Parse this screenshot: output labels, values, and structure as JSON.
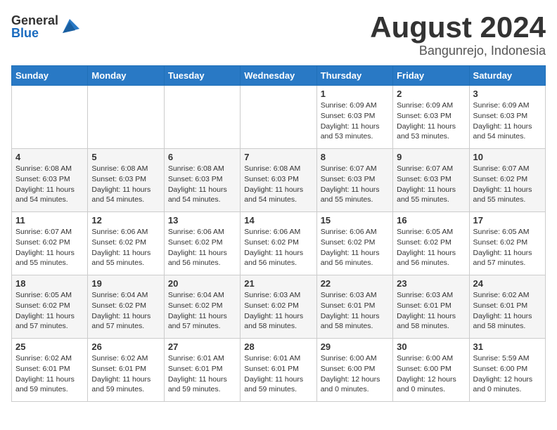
{
  "logo": {
    "general": "General",
    "blue": "Blue"
  },
  "title": {
    "month_year": "August 2024",
    "location": "Bangunrejo, Indonesia"
  },
  "weekdays": [
    "Sunday",
    "Monday",
    "Tuesday",
    "Wednesday",
    "Thursday",
    "Friday",
    "Saturday"
  ],
  "weeks": [
    [
      {
        "day": "",
        "info": ""
      },
      {
        "day": "",
        "info": ""
      },
      {
        "day": "",
        "info": ""
      },
      {
        "day": "",
        "info": ""
      },
      {
        "day": "1",
        "info": "Sunrise: 6:09 AM\nSunset: 6:03 PM\nDaylight: 11 hours\nand 53 minutes."
      },
      {
        "day": "2",
        "info": "Sunrise: 6:09 AM\nSunset: 6:03 PM\nDaylight: 11 hours\nand 53 minutes."
      },
      {
        "day": "3",
        "info": "Sunrise: 6:09 AM\nSunset: 6:03 PM\nDaylight: 11 hours\nand 54 minutes."
      }
    ],
    [
      {
        "day": "4",
        "info": "Sunrise: 6:08 AM\nSunset: 6:03 PM\nDaylight: 11 hours\nand 54 minutes."
      },
      {
        "day": "5",
        "info": "Sunrise: 6:08 AM\nSunset: 6:03 PM\nDaylight: 11 hours\nand 54 minutes."
      },
      {
        "day": "6",
        "info": "Sunrise: 6:08 AM\nSunset: 6:03 PM\nDaylight: 11 hours\nand 54 minutes."
      },
      {
        "day": "7",
        "info": "Sunrise: 6:08 AM\nSunset: 6:03 PM\nDaylight: 11 hours\nand 54 minutes."
      },
      {
        "day": "8",
        "info": "Sunrise: 6:07 AM\nSunset: 6:03 PM\nDaylight: 11 hours\nand 55 minutes."
      },
      {
        "day": "9",
        "info": "Sunrise: 6:07 AM\nSunset: 6:03 PM\nDaylight: 11 hours\nand 55 minutes."
      },
      {
        "day": "10",
        "info": "Sunrise: 6:07 AM\nSunset: 6:02 PM\nDaylight: 11 hours\nand 55 minutes."
      }
    ],
    [
      {
        "day": "11",
        "info": "Sunrise: 6:07 AM\nSunset: 6:02 PM\nDaylight: 11 hours\nand 55 minutes."
      },
      {
        "day": "12",
        "info": "Sunrise: 6:06 AM\nSunset: 6:02 PM\nDaylight: 11 hours\nand 55 minutes."
      },
      {
        "day": "13",
        "info": "Sunrise: 6:06 AM\nSunset: 6:02 PM\nDaylight: 11 hours\nand 56 minutes."
      },
      {
        "day": "14",
        "info": "Sunrise: 6:06 AM\nSunset: 6:02 PM\nDaylight: 11 hours\nand 56 minutes."
      },
      {
        "day": "15",
        "info": "Sunrise: 6:06 AM\nSunset: 6:02 PM\nDaylight: 11 hours\nand 56 minutes."
      },
      {
        "day": "16",
        "info": "Sunrise: 6:05 AM\nSunset: 6:02 PM\nDaylight: 11 hours\nand 56 minutes."
      },
      {
        "day": "17",
        "info": "Sunrise: 6:05 AM\nSunset: 6:02 PM\nDaylight: 11 hours\nand 57 minutes."
      }
    ],
    [
      {
        "day": "18",
        "info": "Sunrise: 6:05 AM\nSunset: 6:02 PM\nDaylight: 11 hours\nand 57 minutes."
      },
      {
        "day": "19",
        "info": "Sunrise: 6:04 AM\nSunset: 6:02 PM\nDaylight: 11 hours\nand 57 minutes."
      },
      {
        "day": "20",
        "info": "Sunrise: 6:04 AM\nSunset: 6:02 PM\nDaylight: 11 hours\nand 57 minutes."
      },
      {
        "day": "21",
        "info": "Sunrise: 6:03 AM\nSunset: 6:02 PM\nDaylight: 11 hours\nand 58 minutes."
      },
      {
        "day": "22",
        "info": "Sunrise: 6:03 AM\nSunset: 6:01 PM\nDaylight: 11 hours\nand 58 minutes."
      },
      {
        "day": "23",
        "info": "Sunrise: 6:03 AM\nSunset: 6:01 PM\nDaylight: 11 hours\nand 58 minutes."
      },
      {
        "day": "24",
        "info": "Sunrise: 6:02 AM\nSunset: 6:01 PM\nDaylight: 11 hours\nand 58 minutes."
      }
    ],
    [
      {
        "day": "25",
        "info": "Sunrise: 6:02 AM\nSunset: 6:01 PM\nDaylight: 11 hours\nand 59 minutes."
      },
      {
        "day": "26",
        "info": "Sunrise: 6:02 AM\nSunset: 6:01 PM\nDaylight: 11 hours\nand 59 minutes."
      },
      {
        "day": "27",
        "info": "Sunrise: 6:01 AM\nSunset: 6:01 PM\nDaylight: 11 hours\nand 59 minutes."
      },
      {
        "day": "28",
        "info": "Sunrise: 6:01 AM\nSunset: 6:01 PM\nDaylight: 11 hours\nand 59 minutes."
      },
      {
        "day": "29",
        "info": "Sunrise: 6:00 AM\nSunset: 6:00 PM\nDaylight: 12 hours\nand 0 minutes."
      },
      {
        "day": "30",
        "info": "Sunrise: 6:00 AM\nSunset: 6:00 PM\nDaylight: 12 hours\nand 0 minutes."
      },
      {
        "day": "31",
        "info": "Sunrise: 5:59 AM\nSunset: 6:00 PM\nDaylight: 12 hours\nand 0 minutes."
      }
    ]
  ]
}
